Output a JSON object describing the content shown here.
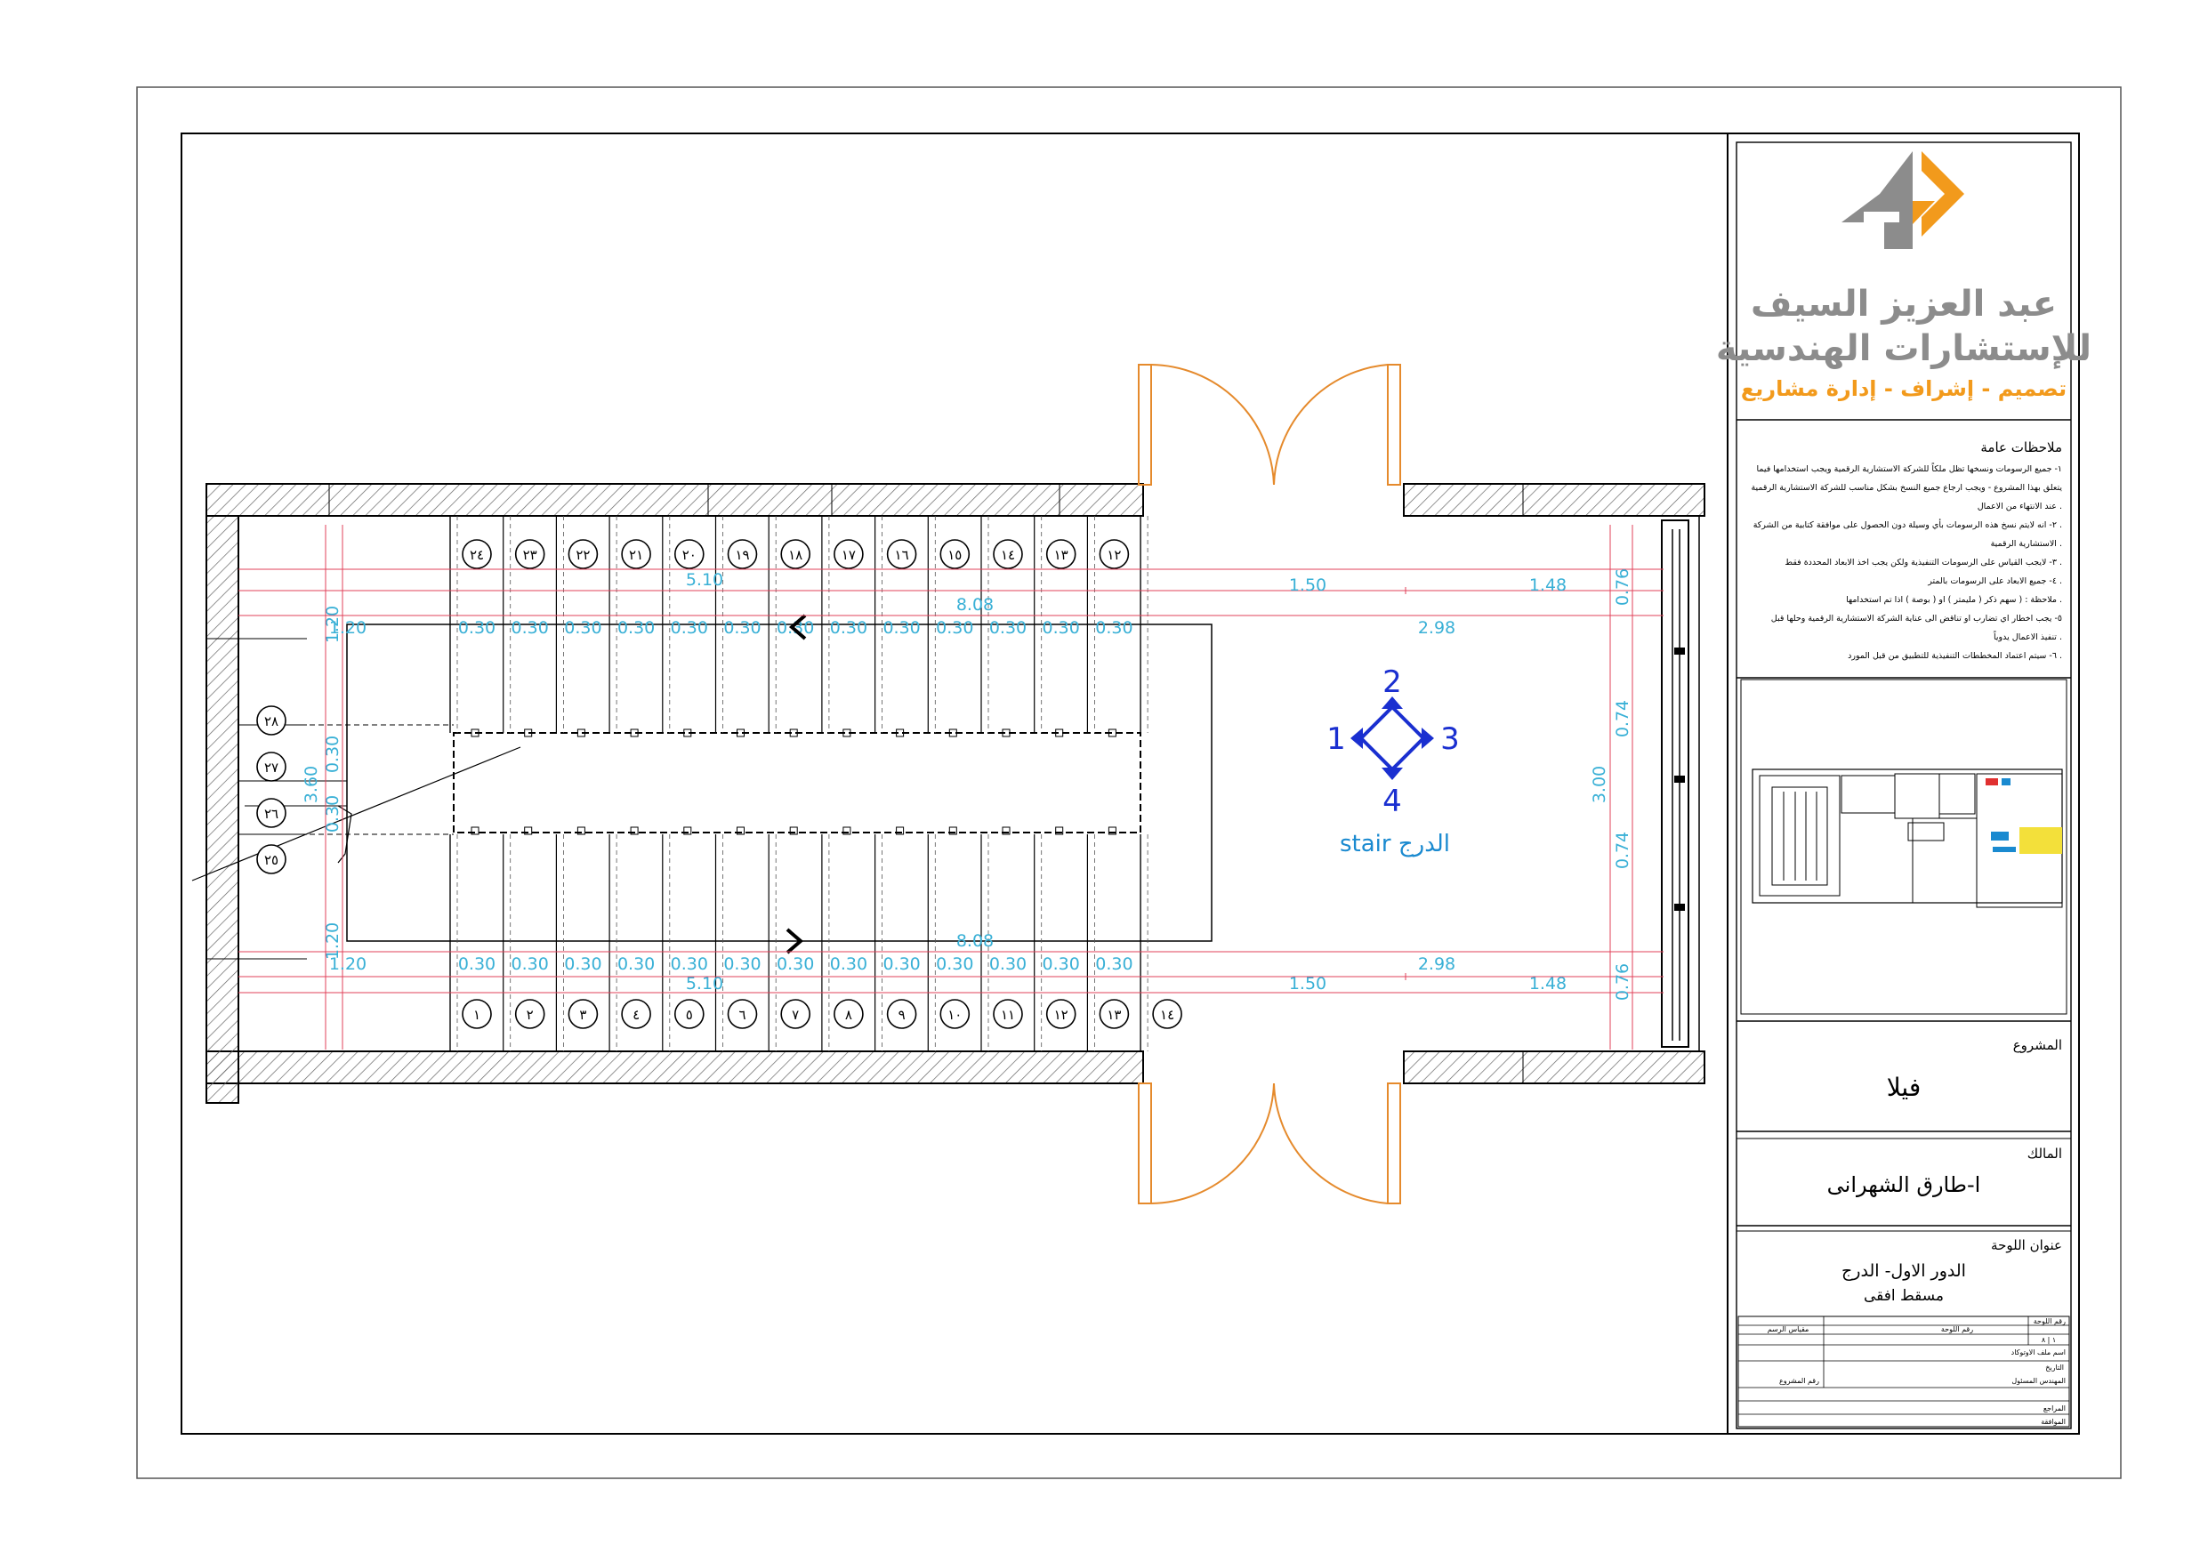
{
  "colors": {
    "line": "#000000",
    "dimension": "#39b0d6",
    "dimension_line": "#e0405a",
    "door": "#e58a2c",
    "marker": "#1a2fd0",
    "logo_orange": "#f29a1c",
    "logo_gray": "#8c8c8c",
    "hatch": "#555555"
  },
  "company": {
    "name_line1": "عبد العزيز السيف",
    "name_line2": "للإستشارات الهندسية",
    "tagline": "تصميم - إشراف - إدارة مشاريع",
    "logo_icon": "4d-arrow-logo-icon"
  },
  "notes": {
    "title": "ملاحظات عامة",
    "items": [
      "١- جميع الرسومات ونسخها تظل ملكاً للشركة الاستشارية الرقمية ويجب استخدامها فيما",
      "يتعلق بهذا المشروع - ويجب ارجاع جميع النسخ بشكل مناسب للشركة الاستشارية الرقمية",
      "عند الانتهاء من الاعمال .",
      "٢- انه لايتم نسخ هذه الرسومات بأي وسيلة دون الحصول على موافقة كتابية من الشركة .",
      "الاستشارية الرقمية .",
      "٣- لايجب القياس على الرسومات التنفيذية ولكن يجب اخذ الابعاد المحددة فقط .",
      "٤- جميع الابعاد على الرسومات بالمتر .",
      "ملاحظة : ( سهم ذكر ( مليمتر ) او ( بوصة ) اذا تم استخدامها .",
      "٥- يجب اخطار اي تضارب او تناقض الى عناية الشركة الاستشارية الرقمية وحلها قبل",
      "تنفيذ الاعمال يدوياً .",
      "٦- سيتم اعتماد المخططات التنفيذية للتطبيق من قبل المورد ."
    ]
  },
  "project": {
    "label": "المشروع",
    "value": "فيلا"
  },
  "owner": {
    "label": "المالك",
    "value": "ا-طارق الشهرانى"
  },
  "sheet_title": {
    "label": "عنوان اللوحة",
    "line1": "الدور الاول- الدرج",
    "line2": "مسقط افقى"
  },
  "info_table": {
    "sheet_no_label": "رقم اللوحة",
    "sheet_no_alt": "رقم اللوحة",
    "scale_label": "مقياس الرسم",
    "file_label": "اسم ملف الاوتوكاد",
    "date_label": "التاريخ",
    "engineer_label": "المهندس المسئول",
    "project_no_label": "رقم المشروع",
    "reviewer_label": "المراجع",
    "approval_label": "الموافقة",
    "sheet_value": "١ | ٨"
  },
  "plan": {
    "stair_label": "stair الدرج",
    "compass": {
      "n": "2",
      "w": "1",
      "e": "3",
      "s": "4"
    },
    "top_step_numbers": [
      "٢٤",
      "٢٣",
      "٢٢",
      "٢١",
      "٢٠",
      "١٩",
      "١٨",
      "١٧",
      "١٦",
      "١٥",
      "١٤",
      "١٣",
      "١٢"
    ],
    "bottom_step_numbers": [
      "١",
      "٢",
      "٣",
      "٤",
      "٥",
      "٦",
      "٧",
      "٨",
      "٩",
      "١٠",
      "١١",
      "١٢",
      "١٣",
      "١٤"
    ],
    "landing_step_numbers": [
      "٢٥",
      "٢٦",
      "٢٧",
      "٢٨"
    ],
    "dims": {
      "tread": "0.30",
      "flight_len": "5.10",
      "total_len": "8.08",
      "landing": "2.98",
      "seg_a": "1.50",
      "seg_b": "1.48",
      "side_a": "0.76",
      "side_b": "0.74",
      "width": "3.00",
      "left_a": "1.20",
      "left_b": "3.60",
      "left_c": "0.30"
    }
  }
}
